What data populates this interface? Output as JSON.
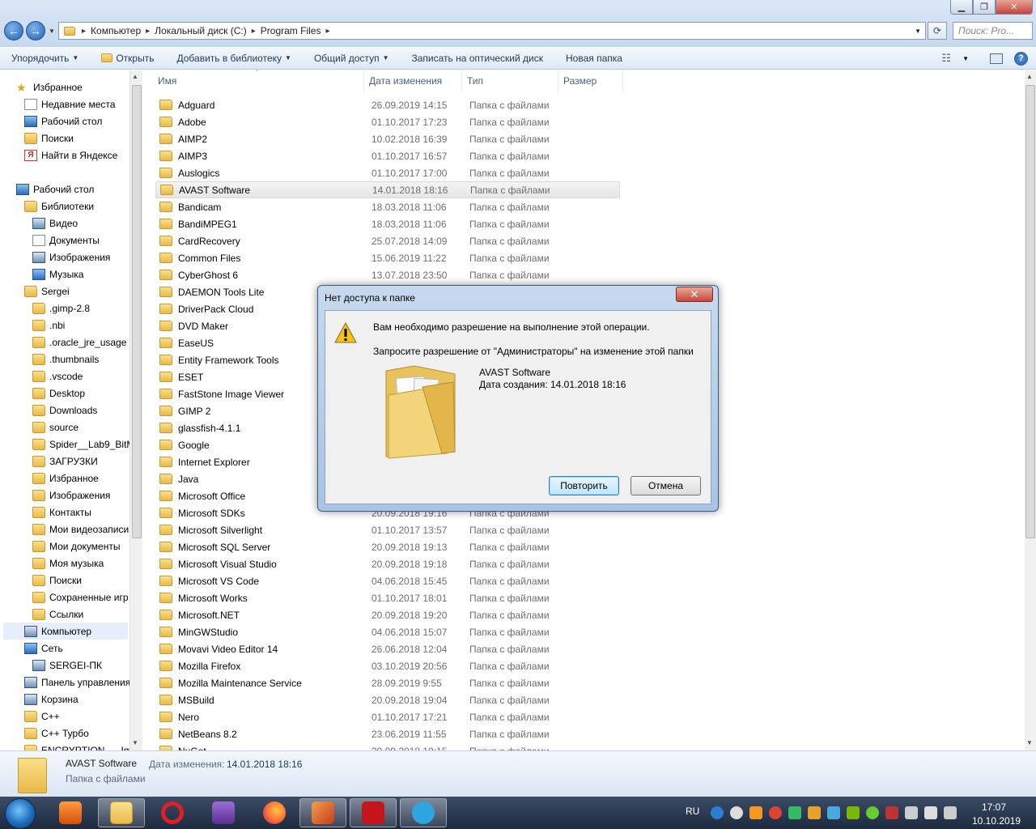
{
  "window": {
    "buttons": {
      "minimize": "▁",
      "maximize": "❐",
      "close": "✕"
    }
  },
  "address": {
    "crumbs": [
      "Компьютер",
      "Локальный диск (C:)",
      "Program Files"
    ],
    "search_placeholder": "Поиск: Pro..."
  },
  "toolbar": {
    "organize": "Упорядочить",
    "open": "Открыть",
    "add_to_library": "Добавить в библиотеку",
    "share": "Общий доступ",
    "burn": "Записать на оптический диск",
    "new_folder": "Новая папка"
  },
  "nav": {
    "items": [
      {
        "label": "Избранное",
        "icon": "star-icon",
        "indent": 0
      },
      {
        "label": "Недавние места",
        "icon": "recent-icon",
        "indent": 1
      },
      {
        "label": "Рабочий стол",
        "icon": "desktop-icon",
        "indent": 1
      },
      {
        "label": "Поиски",
        "icon": "search-folder-icon",
        "indent": 1
      },
      {
        "label": "Найти в Яндексе",
        "icon": "yandex-icon",
        "indent": 1
      },
      {
        "label": "Рабочий стол",
        "icon": "desktop-icon",
        "indent": 0,
        "gap": true
      },
      {
        "label": "Библиотеки",
        "icon": "libraries-icon",
        "indent": 1
      },
      {
        "label": "Видео",
        "icon": "video-icon",
        "indent": 2
      },
      {
        "label": "Документы",
        "icon": "documents-icon",
        "indent": 2
      },
      {
        "label": "Изображения",
        "icon": "pictures-icon",
        "indent": 2
      },
      {
        "label": "Музыка",
        "icon": "music-icon",
        "indent": 2
      },
      {
        "label": "Sergei",
        "icon": "user-folder-icon",
        "indent": 1
      },
      {
        "label": ".gimp-2.8",
        "icon": "folder-icon",
        "indent": 2
      },
      {
        "label": ".nbi",
        "icon": "folder-icon",
        "indent": 2
      },
      {
        "label": ".oracle_jre_usage",
        "icon": "folder-icon",
        "indent": 2
      },
      {
        "label": ".thumbnails",
        "icon": "folder-icon",
        "indent": 2
      },
      {
        "label": ".vscode",
        "icon": "folder-icon",
        "indent": 2
      },
      {
        "label": "Desktop",
        "icon": "folder-icon",
        "indent": 2
      },
      {
        "label": "Downloads",
        "icon": "folder-icon",
        "indent": 2
      },
      {
        "label": "source",
        "icon": "folder-icon",
        "indent": 2
      },
      {
        "label": "Spider__Lab9_BitM",
        "icon": "folder-icon",
        "indent": 2
      },
      {
        "label": "ЗАГРУЗКИ",
        "icon": "folder-icon",
        "indent": 2
      },
      {
        "label": "Избранное",
        "icon": "favorites-folder-icon",
        "indent": 2
      },
      {
        "label": "Изображения",
        "icon": "pictures-folder-icon",
        "indent": 2
      },
      {
        "label": "Контакты",
        "icon": "contacts-icon",
        "indent": 2
      },
      {
        "label": "Мои видеозаписи",
        "icon": "videos-folder-icon",
        "indent": 2
      },
      {
        "label": "Мои документы",
        "icon": "documents-folder-icon",
        "indent": 2
      },
      {
        "label": "Моя музыка",
        "icon": "music-folder-icon",
        "indent": 2
      },
      {
        "label": "Поиски",
        "icon": "search-folder-icon",
        "indent": 2
      },
      {
        "label": "Сохраненные игр",
        "icon": "games-folder-icon",
        "indent": 2
      },
      {
        "label": "Ссылки",
        "icon": "links-folder-icon",
        "indent": 2
      },
      {
        "label": "Компьютер",
        "icon": "computer-icon",
        "indent": 1,
        "selected": true
      },
      {
        "label": "Сеть",
        "icon": "network-icon",
        "indent": 1
      },
      {
        "label": "SERGEI-ПК",
        "icon": "computer-icon",
        "indent": 2
      },
      {
        "label": "Панель управления",
        "icon": "control-panel-icon",
        "indent": 1
      },
      {
        "label": "Корзина",
        "icon": "recycle-bin-icon",
        "indent": 1
      },
      {
        "label": "C++",
        "icon": "folder-icon",
        "indent": 1
      },
      {
        "label": "C++ Турбо",
        "icon": "folder-icon",
        "indent": 1
      },
      {
        "label": "ENCRYPTION___Im",
        "icon": "folder-icon",
        "indent": 1
      }
    ]
  },
  "columns": {
    "name": "Имя",
    "date": "Дата изменения",
    "type": "Тип",
    "size": "Размер"
  },
  "files": [
    {
      "name": "Adguard",
      "date": "26.09.2019 14:15",
      "type": "Папка с файлами"
    },
    {
      "name": "Adobe",
      "date": "01.10.2017 17:23",
      "type": "Папка с файлами"
    },
    {
      "name": "AIMP2",
      "date": "10.02.2018 16:39",
      "type": "Папка с файлами"
    },
    {
      "name": "AIMP3",
      "date": "01.10.2017 16:57",
      "type": "Папка с файлами"
    },
    {
      "name": "Auslogics",
      "date": "01.10.2017 17:00",
      "type": "Папка с файлами"
    },
    {
      "name": "AVAST Software",
      "date": "14.01.2018 18:16",
      "type": "Папка с файлами",
      "selected": true
    },
    {
      "name": "Bandicam",
      "date": "18.03.2018 11:06",
      "type": "Папка с файлами"
    },
    {
      "name": "BandiMPEG1",
      "date": "18.03.2018 11:06",
      "type": "Папка с файлами"
    },
    {
      "name": "CardRecovery",
      "date": "25.07.2018 14:09",
      "type": "Папка с файлами"
    },
    {
      "name": "Common Files",
      "date": "15.06.2019 11:22",
      "type": "Папка с файлами"
    },
    {
      "name": "CyberGhost 6",
      "date": "13.07.2018 23:50",
      "type": "Папка с файлами"
    },
    {
      "name": "DAEMON Tools Lite",
      "date": "",
      "type": ""
    },
    {
      "name": "DriverPack Cloud",
      "date": "",
      "type": ""
    },
    {
      "name": "DVD Maker",
      "date": "",
      "type": ""
    },
    {
      "name": "EaseUS",
      "date": "",
      "type": ""
    },
    {
      "name": "Entity Framework Tools",
      "date": "",
      "type": ""
    },
    {
      "name": "ESET",
      "date": "",
      "type": ""
    },
    {
      "name": "FastStone Image Viewer",
      "date": "",
      "type": ""
    },
    {
      "name": "GIMP 2",
      "date": "",
      "type": ""
    },
    {
      "name": "glassfish-4.1.1",
      "date": "",
      "type": ""
    },
    {
      "name": "Google",
      "date": "",
      "type": ""
    },
    {
      "name": "Internet Explorer",
      "date": "",
      "type": ""
    },
    {
      "name": "Java",
      "date": "",
      "type": ""
    },
    {
      "name": "Microsoft Office",
      "date": "",
      "type": ""
    },
    {
      "name": "Microsoft SDKs",
      "date": "20.09.2018 19:16",
      "type": "Папка с файлами"
    },
    {
      "name": "Microsoft Silverlight",
      "date": "01.10.2017 13:57",
      "type": "Папка с файлами"
    },
    {
      "name": "Microsoft SQL Server",
      "date": "20.09.2018 19:13",
      "type": "Папка с файлами"
    },
    {
      "name": "Microsoft Visual Studio",
      "date": "20.09.2018 19:18",
      "type": "Папка с файлами"
    },
    {
      "name": "Microsoft VS Code",
      "date": "04.06.2018 15:45",
      "type": "Папка с файлами"
    },
    {
      "name": "Microsoft Works",
      "date": "01.10.2017 18:01",
      "type": "Папка с файлами"
    },
    {
      "name": "Microsoft.NET",
      "date": "20.09.2018 19:20",
      "type": "Папка с файлами"
    },
    {
      "name": "MinGWStudio",
      "date": "04.06.2018 15:07",
      "type": "Папка с файлами"
    },
    {
      "name": "Movavi Video Editor 14",
      "date": "26.06.2018 12:04",
      "type": "Папка с файлами"
    },
    {
      "name": "Mozilla Firefox",
      "date": "03.10.2019 20:56",
      "type": "Папка с файлами"
    },
    {
      "name": "Mozilla Maintenance Service",
      "date": "28.09.2019 9:55",
      "type": "Папка с файлами"
    },
    {
      "name": "MSBuild",
      "date": "20.09.2018 19:04",
      "type": "Папка с файлами"
    },
    {
      "name": "Nero",
      "date": "01.10.2017 17:21",
      "type": "Папка с файлами"
    },
    {
      "name": "NetBeans 8.2",
      "date": "23.06.2019 11:55",
      "type": "Папка с файлами"
    },
    {
      "name": "NuGet",
      "date": "20.09.2018 19:15",
      "type": "Папка с файлами"
    }
  ],
  "details": {
    "name": "AVAST Software",
    "date_label": "Дата изменения:",
    "date": "14.01.2018 18:16",
    "type": "Папка с файлами"
  },
  "dialog": {
    "title": "Нет доступа к папке",
    "close": "✕",
    "message1": "Вам необходимо разрешение на выполнение этой операции.",
    "message2": "Запросите разрешение от \"Администраторы\" на изменение этой папки",
    "folder_name": "AVAST Software",
    "folder_date": "Дата создания: 14.01.2018 18:16",
    "retry": "Повторить",
    "cancel": "Отмена"
  },
  "taskbar": {
    "lang": "RU",
    "time": "17:07",
    "date": "10.10.2019",
    "apps": [
      "media-player-icon",
      "explorer-icon",
      "opera-icon",
      "visual-studio-icon",
      "firefox-icon",
      "powerpoint-icon",
      "acrobat-icon",
      "telegram-icon"
    ]
  }
}
